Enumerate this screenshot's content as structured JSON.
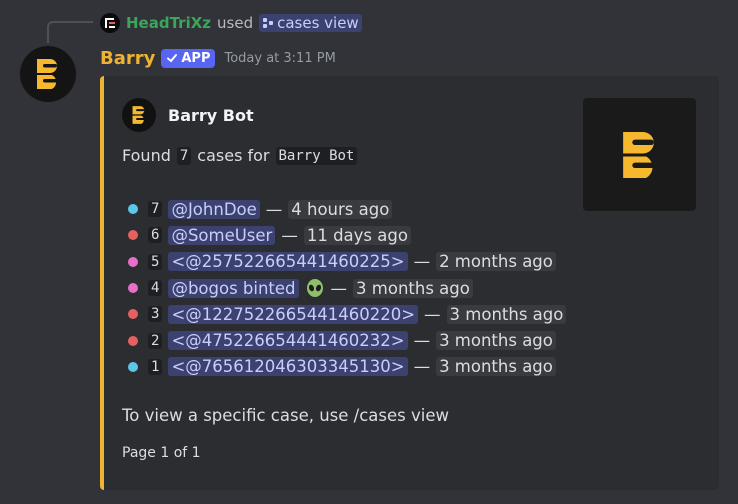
{
  "reply": {
    "username": "HeadTriXz",
    "used_text": "used",
    "command": "cases view",
    "command_icon": "slash-command-icon"
  },
  "message": {
    "username": "Barry",
    "app_tag": "APP",
    "timestamp": "Today at 3:11 PM"
  },
  "embed": {
    "accent_color": "#f0b232",
    "author": "Barry Bot",
    "found_prefix": "Found",
    "found_count": "7",
    "found_middle": "cases for",
    "found_target": "Barry Bot",
    "cases": [
      {
        "number": "7",
        "color": "#5bc8e8",
        "user": "@JohnDoe",
        "sep": "—",
        "time": "4 hours ago"
      },
      {
        "number": "6",
        "color": "#e8605c",
        "user": "@SomeUser",
        "sep": "—",
        "time": "11 days ago"
      },
      {
        "number": "5",
        "color": "#e86fc8",
        "user": "<@257522665441460225>",
        "sep": "—",
        "time": "2 months ago"
      },
      {
        "number": "4",
        "color": "#e86fc8",
        "user": "@bogos binted",
        "sep": "—",
        "time": "3 months ago"
      },
      {
        "number": "3",
        "color": "#e8605c",
        "user": "<@1227522665441460220>",
        "sep": "—",
        "time": "3 months ago"
      },
      {
        "number": "2",
        "color": "#e8605c",
        "user": "<@475226654441460232>",
        "sep": "—",
        "time": "3 months ago"
      },
      {
        "number": "1",
        "color": "#5bc8e8",
        "user": "<@765612046303345130>",
        "sep": "—",
        "time": "3 months ago"
      }
    ],
    "hint": "To view a specific case, use /cases view",
    "footer": "Page 1 of 1"
  }
}
